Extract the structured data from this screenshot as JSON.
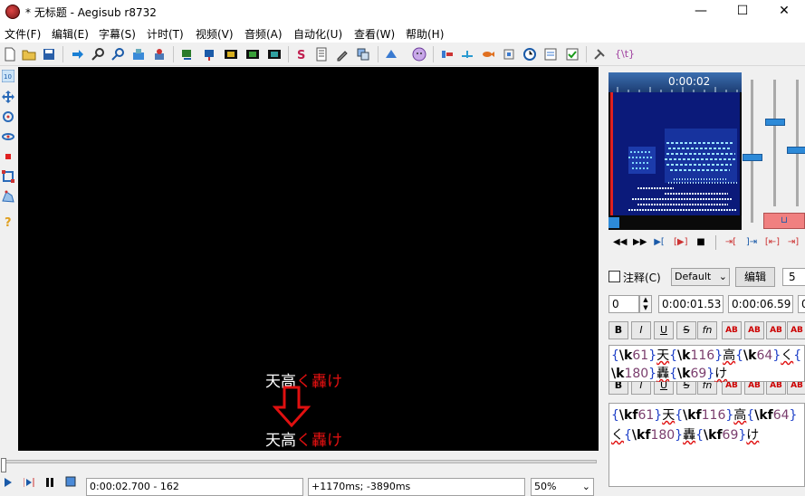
{
  "window": {
    "title": "* 无标题 - Aegisub r8732",
    "min": "—",
    "max": "☐",
    "close": "✕"
  },
  "menu": [
    "文件(F)",
    "编辑(E)",
    "字幕(S)",
    "计时(T)",
    "视频(V)",
    "音频(A)",
    "自动化(U)",
    "查看(W)",
    "帮助(H)"
  ],
  "toolbar": {
    "tags_label": "{\\t}"
  },
  "video": {
    "top_line": {
      "white": "天高",
      "red": "く轟け"
    },
    "arrow": "⇩",
    "bottom_line": {
      "white": "天高",
      "red": "く轟け"
    }
  },
  "status": {
    "time": "0:00:02.700 - 162",
    "offset": "+1170ms; -3890ms",
    "zoom": "50%"
  },
  "audio": {
    "time": "0:00:02"
  },
  "edit": {
    "comment_label": "注释(C)",
    "style": "Default",
    "edit_button": "编辑",
    "actor": "5",
    "layer": "0",
    "start": "0:00:01.53",
    "end": "0:00:06.59",
    "margin": "0",
    "format_buttons": [
      "B",
      "I",
      "U",
      "S",
      "fn",
      "AB",
      "AB",
      "AB",
      "AB"
    ]
  },
  "text_k": {
    "line1": [
      [
        "{",
        "br"
      ],
      [
        "\\k",
        "tgn"
      ],
      [
        "61",
        "tg"
      ],
      [
        "}",
        "br"
      ],
      [
        "天",
        "t"
      ],
      [
        "{",
        "br"
      ],
      [
        "\\k",
        "tgn"
      ],
      [
        "116",
        "tg"
      ],
      [
        "}",
        "br"
      ],
      [
        "高",
        "t"
      ],
      [
        "{",
        "br"
      ],
      [
        "\\k",
        "tgn"
      ],
      [
        "64",
        "tg"
      ],
      [
        "}",
        "br"
      ],
      [
        "く",
        "t"
      ],
      [
        "{",
        "br"
      ]
    ],
    "line2": [
      [
        "\\k",
        "tgn"
      ],
      [
        "180",
        "tg"
      ],
      [
        "}",
        "br"
      ],
      [
        "轟",
        "t"
      ],
      [
        "{",
        "br"
      ],
      [
        "\\k",
        "tgn"
      ],
      [
        "69",
        "tg"
      ],
      [
        "}",
        "br"
      ],
      [
        "け",
        "t"
      ]
    ]
  },
  "text_kf": {
    "line1": [
      [
        "{",
        "br"
      ],
      [
        "\\kf",
        "tgn"
      ],
      [
        "61",
        "tg"
      ],
      [
        "}",
        "br"
      ],
      [
        "天",
        "t"
      ],
      [
        "{",
        "br"
      ],
      [
        "\\kf",
        "tgn"
      ],
      [
        "116",
        "tg"
      ],
      [
        "}",
        "br"
      ],
      [
        "高",
        "t"
      ],
      [
        "{",
        "br"
      ],
      [
        "\\kf",
        "tgn"
      ],
      [
        "64",
        "tg"
      ],
      [
        "}",
        "br"
      ]
    ],
    "line2": [
      [
        "く",
        "t"
      ],
      [
        "{",
        "br"
      ],
      [
        "\\kf",
        "tgn"
      ],
      [
        "180",
        "tg"
      ],
      [
        "}",
        "br"
      ],
      [
        "轟",
        "t"
      ],
      [
        "{",
        "br"
      ],
      [
        "\\kf",
        "tgn"
      ],
      [
        "69",
        "tg"
      ],
      [
        "}",
        "br"
      ],
      [
        "け",
        "t"
      ]
    ]
  },
  "colors": {
    "accent": "#2d8ad8",
    "karaoke_red": "#e01010",
    "tag_blue": "#1e40c8"
  }
}
